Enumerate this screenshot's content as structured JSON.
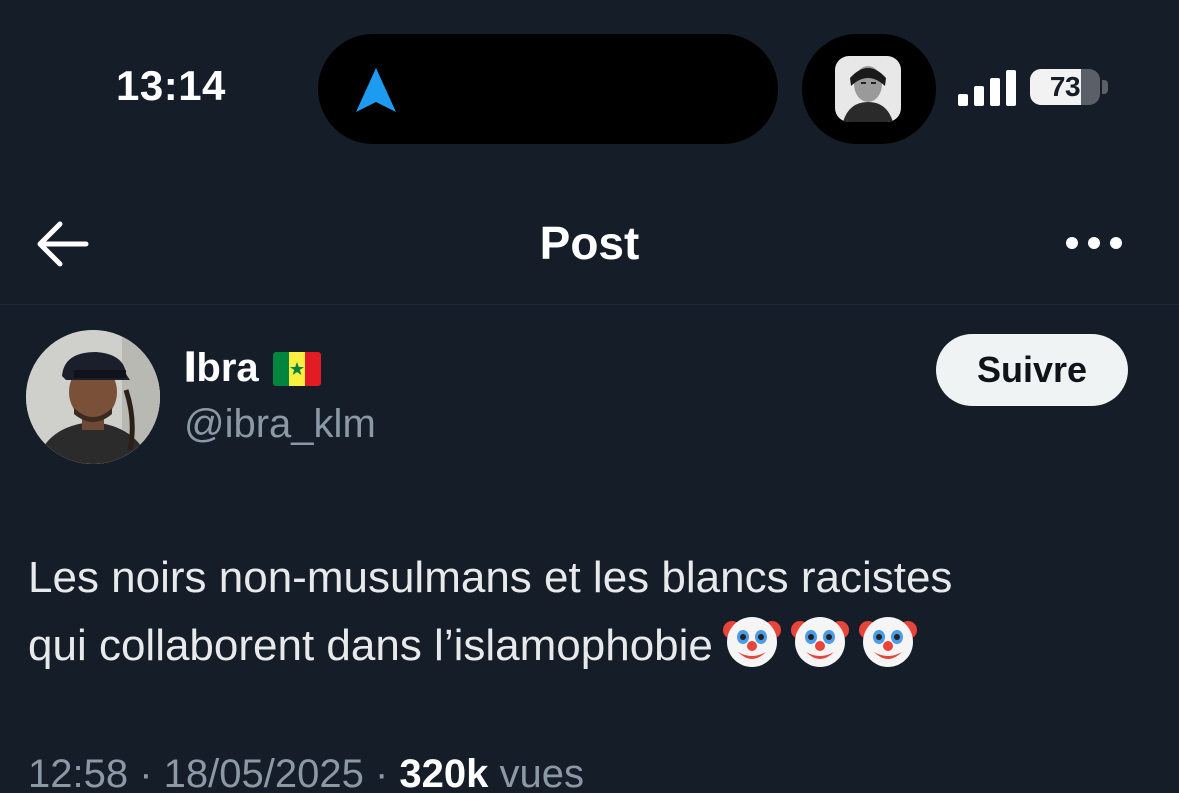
{
  "status_bar": {
    "time": "13:14",
    "battery_level": "73",
    "battery_fraction": 0.73,
    "icons": [
      "navigation-arrow-icon",
      "signal-icon",
      "battery-icon"
    ]
  },
  "header": {
    "title": "Post",
    "back_icon": "arrow-left-icon",
    "more_icon": "more-horizontal-icon"
  },
  "author": {
    "display_name": "𝐈bra",
    "flag": "Senegal flag",
    "handle": "@ibra_klm",
    "follow_label": "Suivre"
  },
  "post": {
    "text_line1": "Les noirs non-musulmans et les blancs racistes",
    "text_line2": "qui collaborent dans l’islamophobie",
    "emojis": [
      "clown-face",
      "clown-face",
      "clown-face"
    ]
  },
  "meta": {
    "time": "12:58",
    "separator": " · ",
    "date": "18/05/2025",
    "views_count": "320k",
    "views_label": "vues"
  },
  "colors": {
    "background": "#151d28",
    "text_primary": "#e7e9ea",
    "text_secondary": "#8b98a5",
    "accent_blue": "#1d9bf0",
    "button_bg": "#eff3f4"
  }
}
